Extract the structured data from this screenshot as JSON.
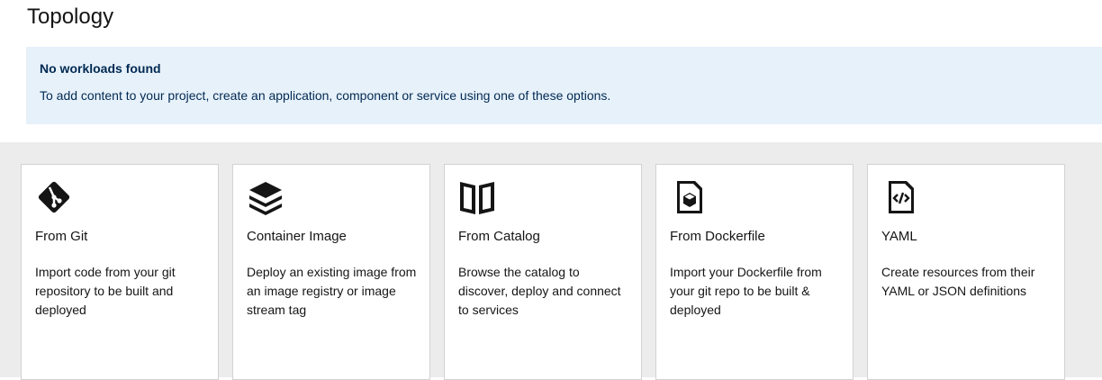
{
  "page": {
    "title": "Topology"
  },
  "alert": {
    "title": "No workloads found",
    "body": "To add content to your project, create an application, component or service using one of these options."
  },
  "cards": [
    {
      "icon": "git-icon",
      "title": "From Git",
      "description": "Import code from your git repository to be built and deployed"
    },
    {
      "icon": "layers-icon",
      "title": "Container Image",
      "description": "Deploy an existing image from an image registry or image stream tag"
    },
    {
      "icon": "book-open-icon",
      "title": "From Catalog",
      "description": "Browse the catalog to discover, deploy and connect to services"
    },
    {
      "icon": "dockerfile-icon",
      "title": "From Dockerfile",
      "description": "Import your Dockerfile from your git repo to be built & deployed"
    },
    {
      "icon": "code-file-icon",
      "title": "YAML",
      "description": "Create resources from their YAML or JSON definitions"
    }
  ],
  "colors": {
    "alert_bg": "#e7f1fa",
    "alert_text": "#002952",
    "cards_bg": "#ececec"
  }
}
